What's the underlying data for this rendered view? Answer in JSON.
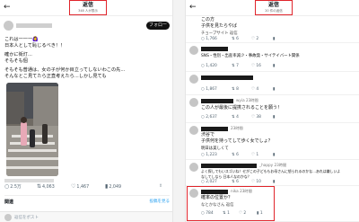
{
  "left": {
    "back_icon": "back-arrow-icon",
    "title": "返信",
    "subtitle": "348 人が表示",
    "follow_label": "フォロー",
    "post_lines": [
      "これは一一一🙆‍♀️",
      "日本人として恥じるべき！！",
      "",
      "確かに街灯...",
      "そもそも個",
      "",
      "そもそも普通は、女の子が何か目立ってしないわこの先...",
      "そんなとこ見てたら正直考えたら...しかし見ても"
    ],
    "actions": {
      "reply": "2.5万",
      "retweet": "4,063",
      "like": "1,467",
      "views": "2,049"
    },
    "related_title": "関連",
    "related_link": "投稿を見る",
    "reply_placeholder": "返信をポスト"
  },
  "right": {
    "title": "返信",
    "subtitle": "20 件の返信",
    "replies": [
      {
        "meta": "この方",
        "lines": [
          "子供を見たらやば",
          "チョープサイト 返信"
        ],
        "actions": {
          "reply": "1,766",
          "retweet": "6",
          "like": "2",
          "views": ""
        }
      },
      {
        "meta": "",
        "lines": [
          "SNS・性別・出産率減少・事故発・サイテイバート関係"
        ],
        "actions": {
          "reply": "1,420",
          "retweet": "7",
          "like": "16",
          "views": ""
        }
      },
      {
        "meta": "",
        "lines": [
          ""
        ],
        "actions": {
          "reply": "1,867",
          "retweet": "8",
          "like": "4",
          "views": ""
        }
      },
      {
        "meta": "wyia 23時間",
        "lines": [
          "この人が最後に提携されることを願う！"
        ],
        "actions": {
          "reply": "2,637",
          "retweet": "4",
          "like": "38",
          "views": ""
        }
      },
      {
        "meta": "23時間",
        "lines": [
          "渋谷で",
          "子供何を持ってして歩く女でしょ？",
          "明日は美しくて"
        ],
        "actions": {
          "reply": "1,223",
          "retweet": "6",
          "like": "1",
          "views": ""
        }
      },
      {
        "meta": "_happy 23時間",
        "lines": [
          "よく探してもいスゴいね！せがこの子どももお母さんに怒られるのかな…あれは嫌しいよ",
          "なしてしなら 日本人なのかな？"
        ],
        "actions": {
          "reply": "2,027",
          "retweet": "6",
          "like": "10",
          "views": ""
        }
      },
      {
        "meta": "nika 23時間",
        "lines": [
          "確率の位置か？",
          "なとかなさん 返信"
        ],
        "actions": {
          "reply": "784",
          "retweet": "1",
          "like": "2",
          "views": "1"
        }
      }
    ]
  },
  "colors": {
    "highlight": "#e0242b",
    "link": "#1d9bf0",
    "muted": "#536471"
  },
  "icons": {
    "reply": "reply-icon",
    "retweet": "retweet-icon",
    "like": "heart-icon",
    "views": "chart-icon"
  }
}
